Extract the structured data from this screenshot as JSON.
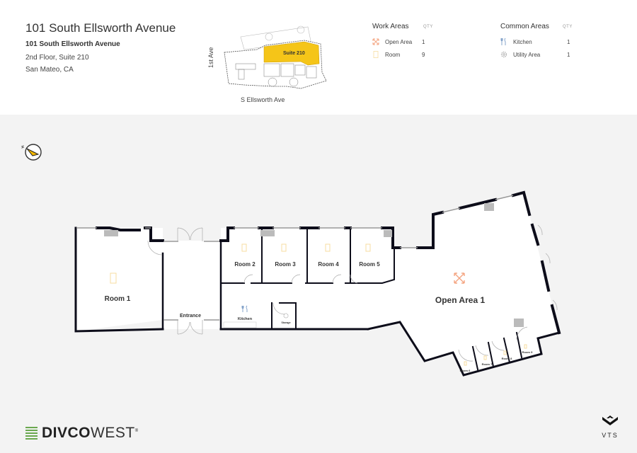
{
  "header": {
    "title": "101 South Ellsworth Avenue",
    "address_name": "101 South Ellsworth Avenue",
    "address_floor": "2nd Floor, Suite 210",
    "address_city": "San Mateo, CA"
  },
  "keymap": {
    "street_left": "1st Ave",
    "street_bottom": "S Ellsworth Ave",
    "suite_label": "Suite 210",
    "highlight_color": "#f5c518"
  },
  "legend": {
    "work": {
      "title": "Work Areas",
      "qty_header": "QTY",
      "items": [
        {
          "icon": "open-area-icon",
          "label": "Open Area",
          "qty": "1"
        },
        {
          "icon": "room-icon",
          "label": "Room",
          "qty": "9"
        }
      ]
    },
    "common": {
      "title": "Common Areas",
      "qty_header": "QTY",
      "items": [
        {
          "icon": "kitchen-icon",
          "label": "Kitchen",
          "qty": "1"
        },
        {
          "icon": "utility-icon",
          "label": "Utility Area",
          "qty": "1"
        }
      ]
    }
  },
  "floorplan": {
    "rooms": [
      {
        "label": "Room 1"
      },
      {
        "label": "Room 2"
      },
      {
        "label": "Room 3"
      },
      {
        "label": "Room 4"
      },
      {
        "label": "Room 5"
      },
      {
        "label": "Room 6"
      },
      {
        "label": "Room 7"
      },
      {
        "label": "Room 8"
      },
      {
        "label": "Room 9"
      }
    ],
    "open_area": "Open Area 1",
    "entrance": "Entrance",
    "kitchen": "Kitchen",
    "storage": "Storage",
    "colors": {
      "wall": "#0d0d1a",
      "open_area_icon": "#f4a582",
      "room_icon": "#f7dca0",
      "common_icon": "#7a9cc6"
    }
  },
  "footer": {
    "brand_bold": "DIVCO",
    "brand_light": "WEST",
    "brand_mark": "®",
    "vts_label": "VTS"
  }
}
